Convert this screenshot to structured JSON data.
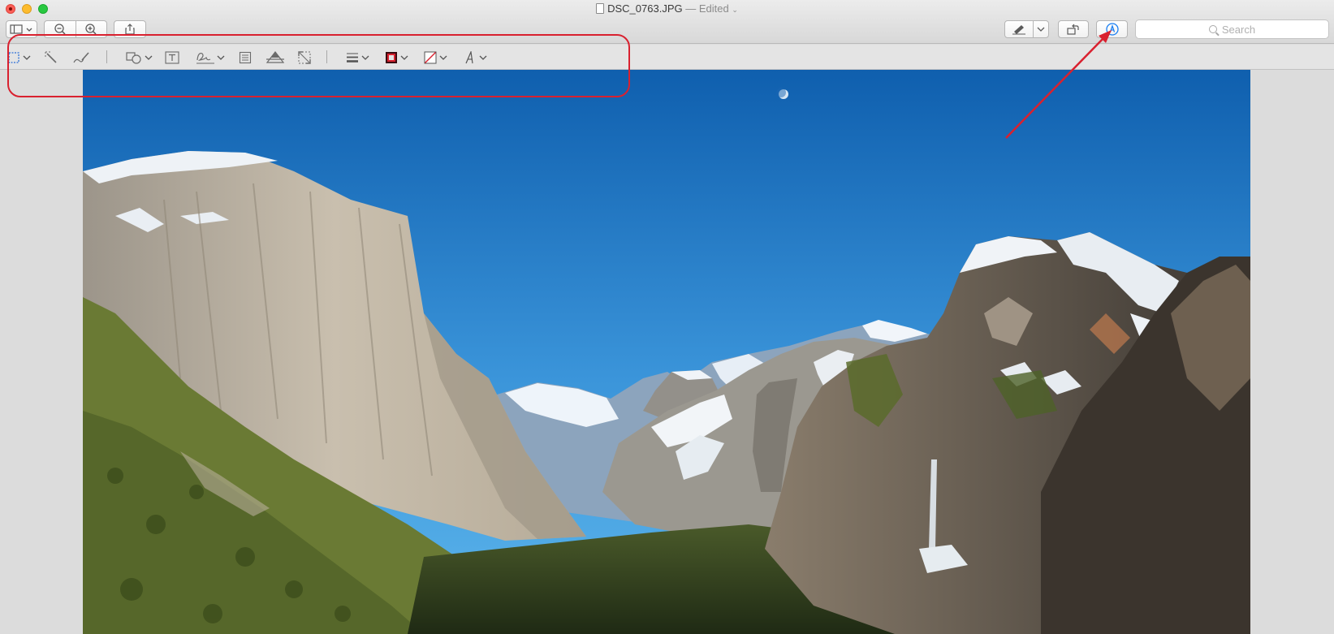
{
  "window": {
    "file_name": "DSC_0763.JPG",
    "status": "— Edited"
  },
  "toolbar": {
    "search_placeholder": "Search"
  },
  "colors": {
    "annotation_red": "#d9212f",
    "accent_blue": "#1a7ef2",
    "sky_top": "#0f5fae",
    "sky_bottom": "#4aa7e4"
  },
  "markup_tools": [
    "selection-tool",
    "instant-alpha",
    "sketch",
    "shapes",
    "text",
    "sign",
    "note",
    "adjust-color",
    "adjust-size",
    "shape-style",
    "border-color",
    "fill-color",
    "text-style"
  ]
}
